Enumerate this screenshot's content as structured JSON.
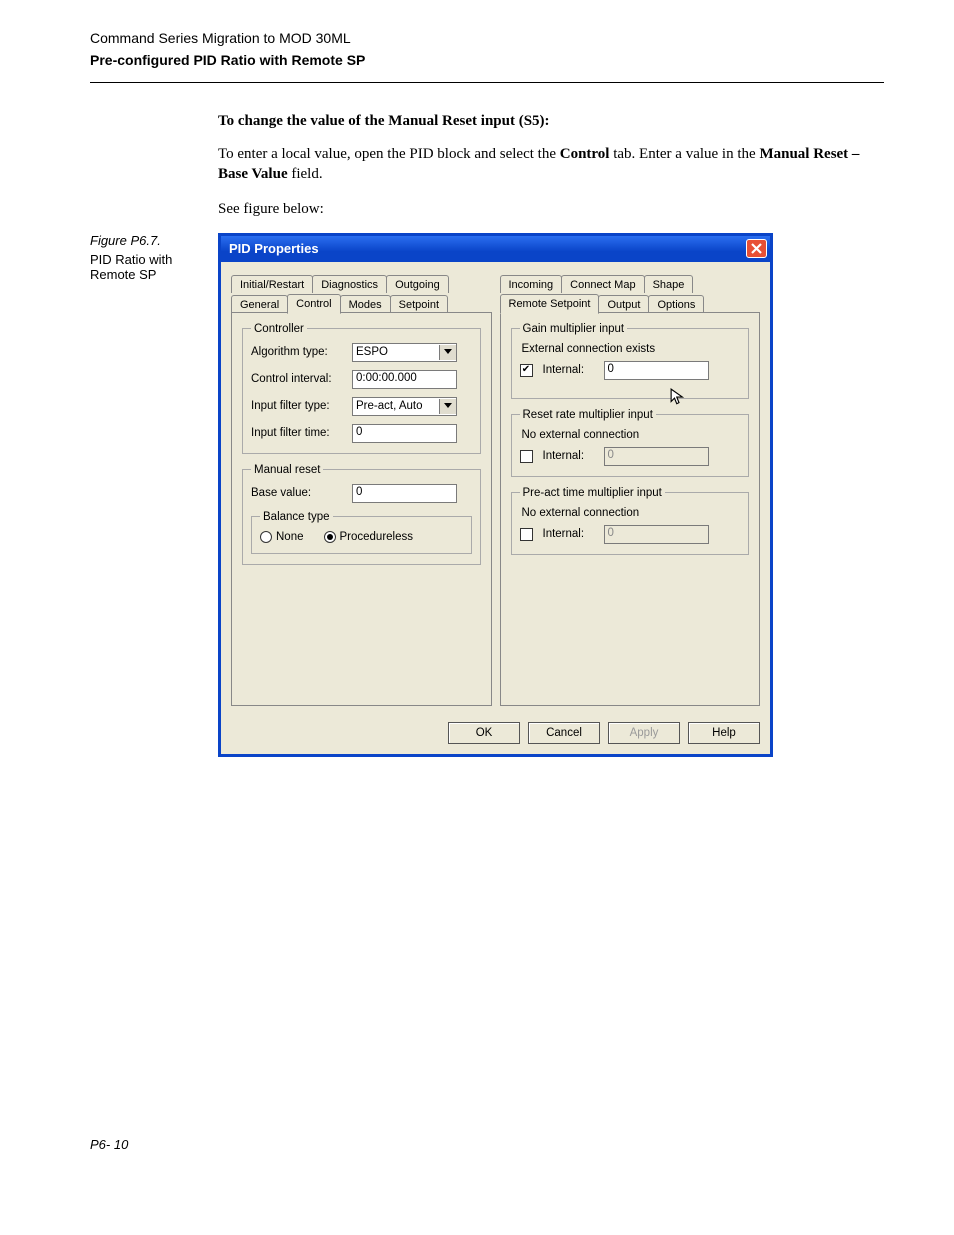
{
  "doc": {
    "header": "Command Series Migration to MOD 30ML",
    "subheader": "Pre-configured PID Ratio with Remote SP",
    "instr_heading": "To change the value of the Manual Reset input (S5):",
    "instr_para_pre": "To enter a local value, open the PID block and select the ",
    "instr_para_bold1": "Control",
    "instr_para_mid": " tab. Enter a value in the ",
    "instr_para_bold2": "Manual Reset – Base Value",
    "instr_para_post": " field.",
    "see_figure": "See figure below:",
    "figure_label": "Figure P6.7.",
    "figure_caption": "PID Ratio with Remote SP",
    "page_foot": "P6- 10"
  },
  "dialog": {
    "title": "PID Properties",
    "left_tabs_row1": [
      "Initial/Restart",
      "Diagnostics",
      "Outgoing"
    ],
    "left_tabs_row2": [
      "General",
      "Control",
      "Modes",
      "Setpoint"
    ],
    "left_active_tab": "Control",
    "right_tabs_row1": [
      "Incoming",
      "Connect Map",
      "Shape"
    ],
    "right_tabs_row2": [
      "Remote Setpoint",
      "Output",
      "Options"
    ],
    "right_active_tab": "Remote Setpoint",
    "controller_legend": "Controller",
    "algo_label": "Algorithm type:",
    "algo_value": "ESPO",
    "interval_label": "Control interval:",
    "interval_value": "0:00:00.000",
    "filter_type_label": "Input filter type:",
    "filter_type_value": "Pre-act, Auto",
    "filter_time_label": "Input filter time:",
    "filter_time_value": "0",
    "manual_reset_legend": "Manual reset",
    "base_value_label": "Base value:",
    "base_value_value": "0",
    "balance_legend": "Balance type",
    "balance_none": "None",
    "balance_procless": "Procedureless",
    "gain_legend": "Gain multiplier input",
    "gain_status": "External connection exists",
    "internal_label": "Internal:",
    "gain_value": "0",
    "reset_legend": "Reset rate multiplier input",
    "no_ext": "No external connection",
    "reset_value": "0",
    "preact_legend": "Pre-act time multiplier input",
    "preact_value": "0",
    "btn_ok": "OK",
    "btn_cancel": "Cancel",
    "btn_apply": "Apply",
    "btn_help": "Help"
  }
}
